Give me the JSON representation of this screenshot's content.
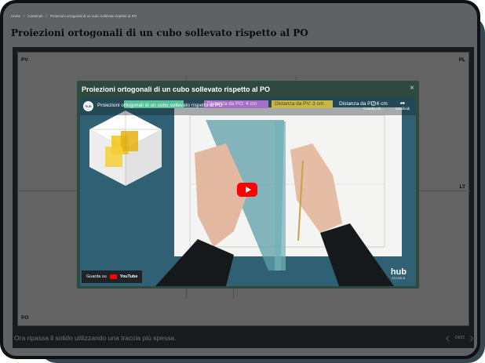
{
  "breadcrumb": {
    "home": "Home",
    "section": "Contenuti",
    "current": "Proiezioni ortogonali di un cubo sollevato rispetto al PO",
    "sep": "/"
  },
  "page": {
    "title": "Proiezioni ortogonali di un cubo sollevato rispetto al PO"
  },
  "drawing": {
    "label_pv": "PV",
    "label_pl": "PL",
    "label_lt": "LT",
    "label_po": "PO"
  },
  "slide": {
    "caption": "Ora ripassa il solido utilizzando una traccia più spessa.",
    "counter": "14/22",
    "prev_icon": "‹",
    "next_icon": "›"
  },
  "modal": {
    "title": "Proiezioni ortogonali di un cubo sollevato rispetto al PO",
    "close": "×",
    "video": {
      "channel_logo": "hub",
      "title": "Proiezioni ortogonali di un cubo sollevato rispetto al PO",
      "tag_po": "Distanza da PO: 4 cm",
      "tag_pv": "Distanza da PV: 3 cm",
      "tag_pl": "Distanza da PL: 6 cm",
      "watch_later": "Guarda più...",
      "share": "Condividi",
      "watch_on": "Guarda su",
      "youtube": "YouTube",
      "hub_big": "hub",
      "hub_small": "SCUOLA"
    }
  },
  "colors": {
    "youtube_red": "#ff0000",
    "modal_bg": "#2e4a3f",
    "slide_bg": "#181b1d"
  }
}
